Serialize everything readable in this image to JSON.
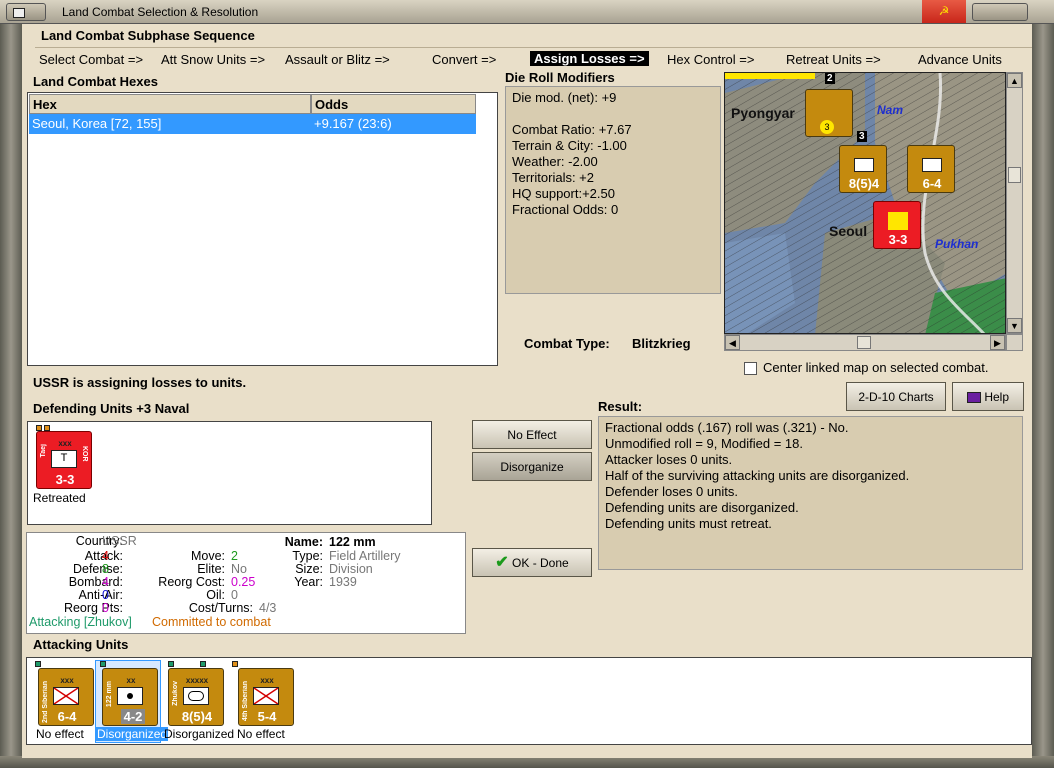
{
  "window": {
    "title": "Land Combat Selection & Resolution"
  },
  "subphase": {
    "heading": "Land Combat Subphase Sequence",
    "steps": [
      {
        "label": "Select Combat =>"
      },
      {
        "label": "Att Snow Units =>"
      },
      {
        "label": "Assault or Blitz =>"
      },
      {
        "label": "Convert =>"
      },
      {
        "label": "Assign Losses =>",
        "active": true
      },
      {
        "label": "Hex Control =>"
      },
      {
        "label": "Retreat Units =>"
      },
      {
        "label": "Advance Units"
      }
    ]
  },
  "hexes": {
    "heading": "Land Combat Hexes",
    "col_hex": "Hex",
    "col_odds": "Odds",
    "rows": [
      {
        "hex": "Seoul, Korea [72, 155]",
        "odds": "+9.167 (23:6)"
      }
    ]
  },
  "drm": {
    "heading": "Die Roll Modifiers",
    "lines": [
      "Die mod. (net): +9",
      "",
      "Combat Ratio: +7.67",
      "Terrain & City: -1.00",
      "Weather: -2.00",
      "Territorials: +2",
      "HQ support:+2.50",
      "Fractional Odds: 0"
    ]
  },
  "combat_type": {
    "label": "Combat Type:",
    "value": "Blitzkrieg"
  },
  "map": {
    "labels": {
      "pyongyang": "Pyongyar",
      "seoul": "Seoul",
      "nam": "Nam",
      "pukhan": "Pukhan"
    },
    "counters": [
      {
        "str": "8(5)4",
        "size": "xxxxx"
      },
      {
        "str": "6-4",
        "size": "xxx"
      },
      {
        "str": "3-3",
        "size": "xxx"
      }
    ],
    "stack_numbers": [
      "2",
      "3",
      "3"
    ],
    "center_linked_label": "Center linked map on selected combat.",
    "center_linked_checked": false
  },
  "status_message": "USSR is assigning losses to units.",
  "defending": {
    "heading": "Defending Units +3 Naval",
    "units": [
      {
        "size": "xxx",
        "str": "3-3",
        "name": "Taej",
        "name2": "KOR",
        "symbol": "T",
        "caption": "Retreated",
        "color": "red"
      }
    ]
  },
  "actions": {
    "no_effect": "No Effect",
    "disorganize": "Disorganize",
    "ok_done": "OK - Done",
    "charts": "2-D-10 Charts",
    "help": "Help"
  },
  "result": {
    "heading": "Result:",
    "lines": [
      "Fractional odds (.167) roll was (.321)  - No.",
      "Unmodified roll = 9, Modified = 18.",
      "Attacker loses 0 units.",
      "Half of the surviving attacking units are disorganized.",
      "Defender loses 0 units.",
      "Defending units are disorganized.",
      "Defending units must retreat."
    ]
  },
  "unit_info": {
    "country_label": "Country:",
    "country": "USSR",
    "attack_label": "Attack:",
    "attack": "4",
    "defense_label": "Defense:",
    "defense": "8",
    "bombard_label": "Bombard:",
    "bombard": "4",
    "antiair_label": "Anti-Air:",
    "antiair": "0",
    "reorg_pts_label": "Reorg Pts:",
    "reorg_pts": "0",
    "move_label": "Move:",
    "move": "2",
    "elite_label": "Elite:",
    "elite": "No",
    "reorg_cost_label": "Reorg Cost:",
    "reorg_cost": "0.25",
    "oil_label": "Oil:",
    "oil": "0",
    "cost_turns_label": "Cost/Turns:",
    "cost_turns": "4/3",
    "name_label": "Name:",
    "name": "122 mm",
    "type_label": "Type:",
    "type": "Field Artillery",
    "size_label": "Size:",
    "size": "Division",
    "year_label": "Year:",
    "year": "1939",
    "attacking_note": "Attacking [Zhukov]",
    "committed_note": "Committed to combat"
  },
  "attacking": {
    "heading": "Attacking Units",
    "units": [
      {
        "size": "xxx",
        "str": "6-4",
        "name": "2nd Siberian",
        "caption": "No effect"
      },
      {
        "size": "xx",
        "str": "4-2",
        "name": "122 mm",
        "caption": "Disorganized",
        "selected": true
      },
      {
        "size": "xxxxx",
        "str": "8(5)4",
        "name": "Zhukov",
        "caption": "Disorganized"
      },
      {
        "size": "xxx",
        "str": "5-4",
        "name": "4th Siberian",
        "caption": "No effect"
      }
    ]
  },
  "colors": {
    "unit_brown": "#c48a0e",
    "unit_red": "#ec1c24",
    "selection_blue": "#3399ff",
    "attack_red": "#d40000",
    "defense_green": "#1f9a1f",
    "bombard_magenta": "#cc00cc",
    "antiair_blue": "#1010d0"
  },
  "icons": {
    "ok": "checkmark-icon",
    "help": "book-icon",
    "infantry": "infantry-cross-icon",
    "artillery": "artillery-dot-icon",
    "armor": "armor-oval-icon"
  }
}
